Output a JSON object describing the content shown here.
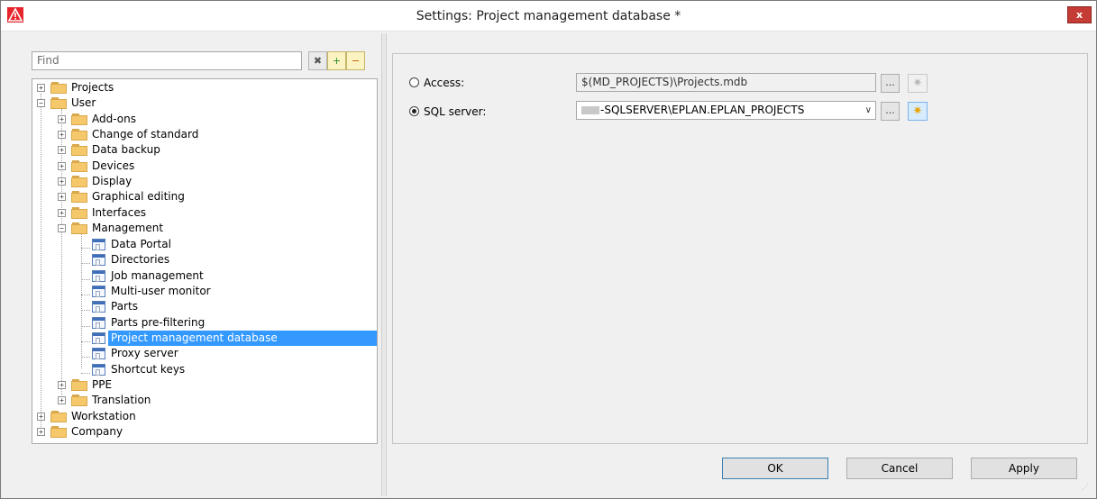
{
  "window": {
    "title": "Settings: Project management database *",
    "close_label": "x"
  },
  "find": {
    "placeholder": "Find"
  },
  "toolbar": {
    "clear_glyph": "✖",
    "expand_glyph": "+",
    "collapse_glyph": "−"
  },
  "tree": {
    "expander_plus": "+",
    "expander_minus": "−",
    "items": [
      {
        "label": "Projects"
      },
      {
        "label": "User"
      },
      {
        "label": "Add-ons"
      },
      {
        "label": "Change of standard"
      },
      {
        "label": "Data backup"
      },
      {
        "label": "Devices"
      },
      {
        "label": "Display"
      },
      {
        "label": "Graphical editing"
      },
      {
        "label": "Interfaces"
      },
      {
        "label": "Management"
      },
      {
        "label": "Data Portal"
      },
      {
        "label": "Directories"
      },
      {
        "label": "Job management"
      },
      {
        "label": "Multi-user monitor"
      },
      {
        "label": "Parts"
      },
      {
        "label": "Parts pre-filtering"
      },
      {
        "label": "Project management database"
      },
      {
        "label": "Proxy server"
      },
      {
        "label": "Shortcut keys"
      },
      {
        "label": "PPE"
      },
      {
        "label": "Translation"
      },
      {
        "label": "Workstation"
      },
      {
        "label": "Company"
      }
    ]
  },
  "settings": {
    "access": {
      "label": "Access:",
      "value": "$(MD_PROJECTS)\\Projects.mdb",
      "selected": false
    },
    "sql": {
      "label": "SQL server:",
      "value": "-SQLSERVER\\EPLAN.EPLAN_PROJECTS",
      "selected": true
    },
    "browse_label": "...",
    "star_glyph": "✷",
    "combo_arrow": "∨"
  },
  "buttons": {
    "ok": "OK",
    "cancel": "Cancel",
    "apply": "Apply"
  },
  "icons": {
    "app": "eplan-warning-icon",
    "folder": "folder-icon",
    "page": "settings-page-icon"
  },
  "colors": {
    "selection": "#3399ff",
    "close": "#c43c35",
    "app_icon": "#e6262c"
  }
}
